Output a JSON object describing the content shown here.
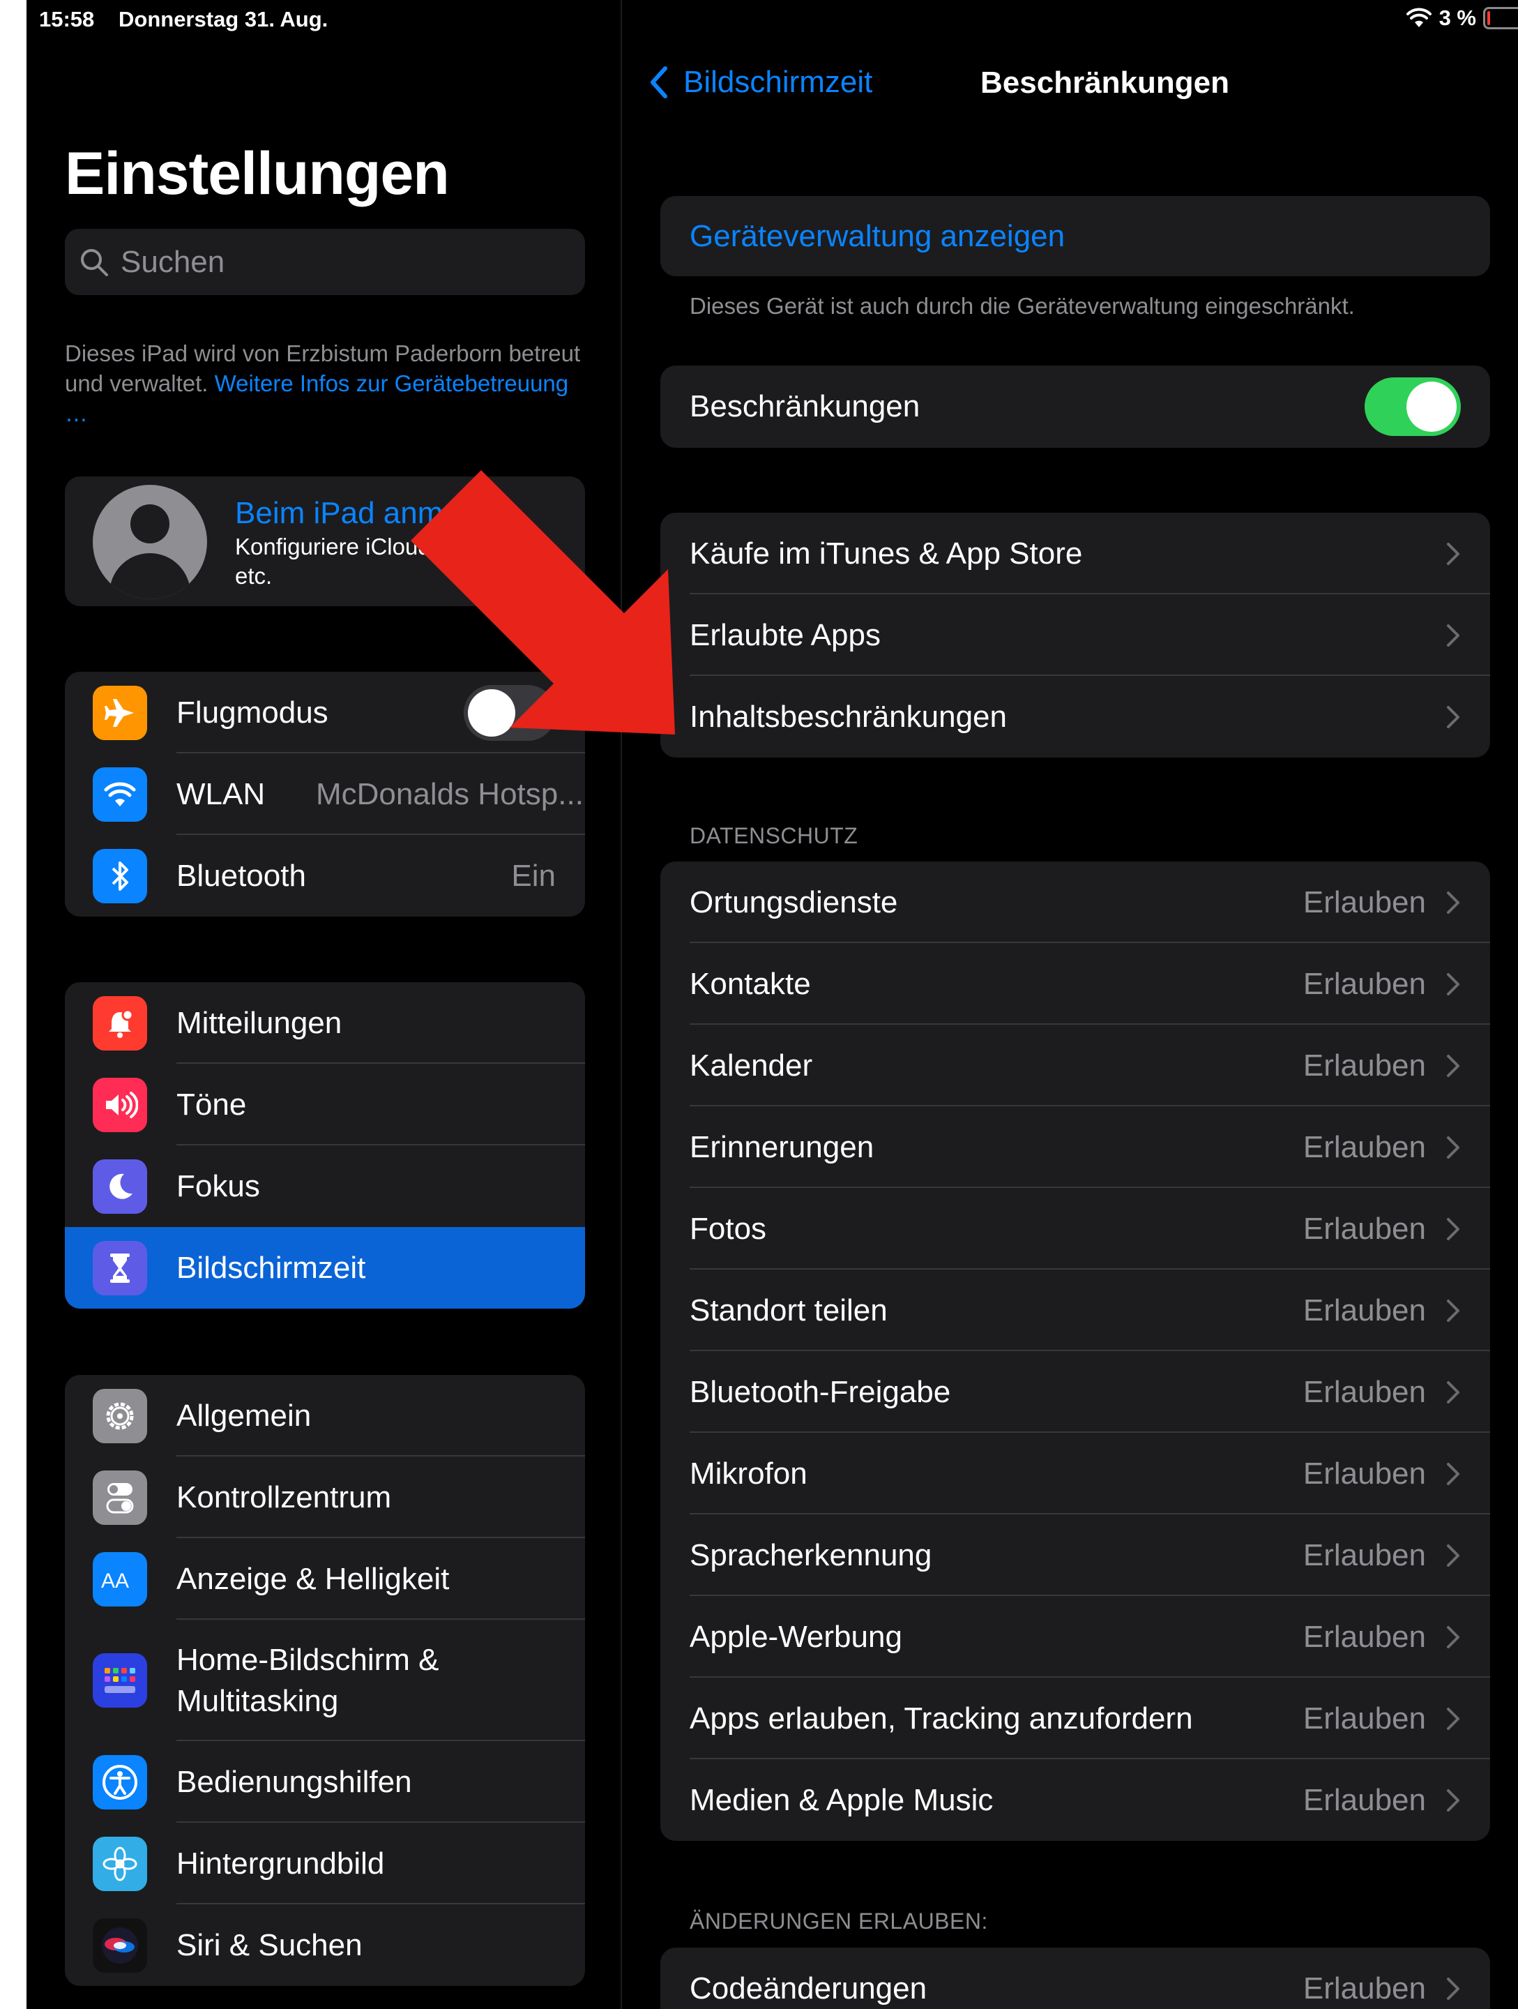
{
  "status": {
    "time": "15:58",
    "date": "Donnerstag 31. Aug.",
    "battery": "3 %"
  },
  "sidebar": {
    "title": "Einstellungen",
    "search_placeholder": "Suchen",
    "management_note": "Dieses iPad wird von Erzbistum Paderborn betreut und verwaltet.",
    "management_link": "Weitere Infos zur Gerätebetreuung …",
    "account": {
      "title": "Beim iPad anmelden",
      "subtitle": "Konfiguriere iCloud, App Store etc."
    },
    "connectivity": [
      {
        "label": "Flugmodus",
        "icon": "airplane-icon"
      },
      {
        "label": "WLAN",
        "value": "McDonalds Hotsp...",
        "icon": "wifi-icon"
      },
      {
        "label": "Bluetooth",
        "value": "Ein",
        "icon": "bluetooth-icon"
      }
    ],
    "alerts": [
      {
        "label": "Mitteilungen",
        "icon": "notifications-icon"
      },
      {
        "label": "Töne",
        "icon": "sounds-icon"
      },
      {
        "label": "Fokus",
        "icon": "focus-moon-icon"
      },
      {
        "label": "Bildschirmzeit",
        "icon": "hourglass-icon",
        "selected": true
      }
    ],
    "general": [
      {
        "label": "Allgemein",
        "icon": "gear-icon"
      },
      {
        "label": "Kontrollzentrum",
        "icon": "control-center-icon"
      },
      {
        "label": "Anzeige & Helligkeit",
        "icon": "display-icon"
      },
      {
        "label": "Home-Bildschirm & Multitasking",
        "icon": "home-screen-icon"
      },
      {
        "label": "Bedienungshilfen",
        "icon": "accessibility-icon"
      },
      {
        "label": "Hintergrundbild",
        "icon": "wallpaper-icon"
      },
      {
        "label": "Siri & Suchen",
        "icon": "siri-icon"
      }
    ]
  },
  "detail": {
    "back_label": "Bildschirmzeit",
    "title": "Beschränkungen",
    "device_management_link": "Geräteverwaltung anzeigen",
    "device_management_note": "Dieses Gerät ist auch durch die Geräteverwaltung eingeschränkt.",
    "restrictions_label": "Beschränkungen",
    "restrictions_on": true,
    "store_items": [
      "Käufe im iTunes & App Store",
      "Erlaubte Apps",
      "Inhaltsbeschränkungen"
    ],
    "privacy_header": "DATENSCHUTZ",
    "privacy_items": [
      {
        "label": "Ortungsdienste",
        "value": "Erlauben"
      },
      {
        "label": "Kontakte",
        "value": "Erlauben"
      },
      {
        "label": "Kalender",
        "value": "Erlauben"
      },
      {
        "label": "Erinnerungen",
        "value": "Erlauben"
      },
      {
        "label": "Fotos",
        "value": "Erlauben"
      },
      {
        "label": "Standort teilen",
        "value": "Erlauben"
      },
      {
        "label": "Bluetooth-Freigabe",
        "value": "Erlauben"
      },
      {
        "label": "Mikrofon",
        "value": "Erlauben"
      },
      {
        "label": "Spracherkennung",
        "value": "Erlauben"
      },
      {
        "label": "Apple-Werbung",
        "value": "Erlauben"
      },
      {
        "label": "Apps erlauben, Tracking anzufordern",
        "value": "Erlauben"
      },
      {
        "label": "Medien & Apple Music",
        "value": "Erlauben"
      }
    ],
    "changes_header": "ÄNDERUNGEN ERLAUBEN:",
    "changes_items": [
      {
        "label": "Codeänderungen",
        "value": "Erlauben"
      }
    ]
  },
  "colors": {
    "accent": "#0a84ff",
    "toggle_on": "#30d158",
    "annotation_arrow": "#e8231a",
    "selected_row": "#0a64d6"
  }
}
